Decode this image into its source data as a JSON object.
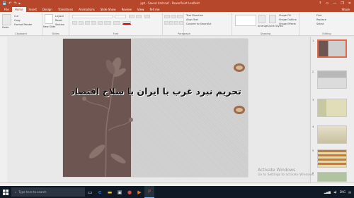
{
  "titlebar": {
    "title": "ppt - Saved Unitroof - PowerPoint Leafield",
    "qat": [
      "💾",
      "↶",
      "↷",
      "▸"
    ],
    "controls": [
      "?",
      "▭",
      "—",
      "❐",
      "✕"
    ]
  },
  "tabs": {
    "items": [
      "File",
      "Home",
      "Insert",
      "Design",
      "Transitions",
      "Animations",
      "Slide Show",
      "Review",
      "View",
      "Tell me"
    ],
    "share": "Share"
  },
  "ribbon": {
    "clipboard": "Clipboard",
    "slides": "Slides",
    "font": "Font",
    "paragraph": "Paragraph",
    "drawing": "Drawing",
    "editing": "Editing",
    "new_slide": "New Slide",
    "layout": "Layout",
    "reset": "Reset",
    "section": "Section",
    "text_direction": "Text Direction",
    "align_text": "Align Text",
    "convert_smartart": "Convert to SmartArt",
    "arrange": "Arrange",
    "quick_styles": "Quick Styles",
    "shape_fill": "Shape Fill",
    "shape_outline": "Shape Outline",
    "shape_effects": "Shape Effects",
    "find": "Find",
    "replace": "Replace",
    "select": "Select",
    "paste": "Paste",
    "cut": "Cut",
    "copy": "Copy",
    "format_painter": "Format Painter"
  },
  "slide": {
    "title": "تحریم  نبرد غرب با ایران با سلاح اقتصاد"
  },
  "watermark": {
    "line1": "Activate Windows",
    "line2": "Go to Settings to activate Windows."
  },
  "thumbnails": [
    "1",
    "2",
    "3",
    "4",
    "5",
    "6"
  ],
  "taskbar": {
    "search_placeholder": "Type here to search",
    "time": "ENG"
  },
  "colors": {
    "accent": "#b7472a",
    "slide_left": "#6d5551",
    "taskbar": "#101a26"
  }
}
